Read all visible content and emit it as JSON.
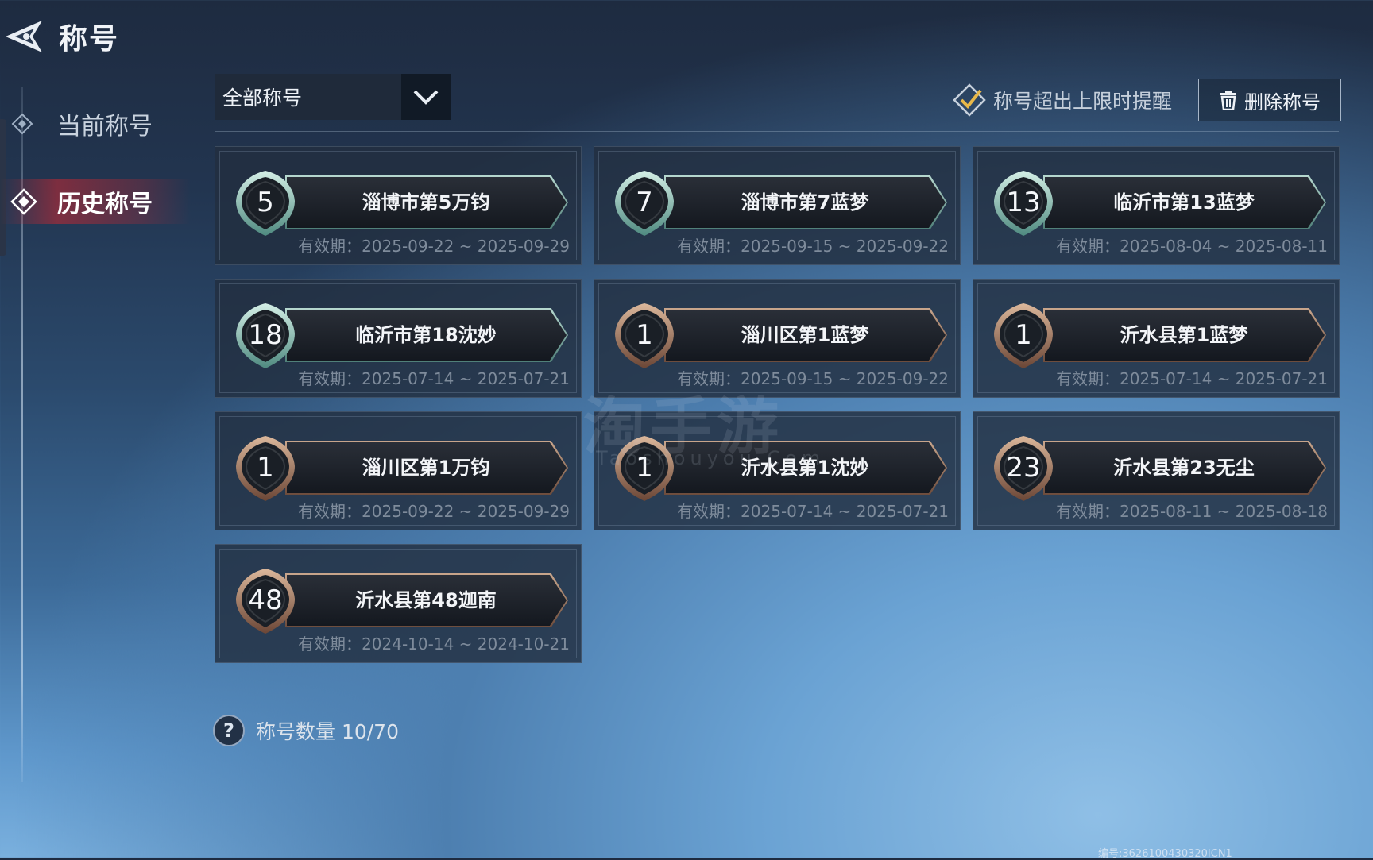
{
  "header": {
    "title": "称号"
  },
  "nav": {
    "current_label": "当前称号",
    "history_label": "历史称号"
  },
  "filter": {
    "selected": "全部称号"
  },
  "toolbar": {
    "reminder_label": "称号超出上限时提醒",
    "delete_label": "删除称号"
  },
  "validity_prefix": "有效期：",
  "cards": [
    {
      "rank": "5",
      "title": "淄博市第5万钧",
      "validity": "2025-09-22 ~ 2025-09-29",
      "style": "teal"
    },
    {
      "rank": "7",
      "title": "淄博市第7蓝梦",
      "validity": "2025-09-15 ~ 2025-09-22",
      "style": "teal"
    },
    {
      "rank": "13",
      "title": "临沂市第13蓝梦",
      "validity": "2025-08-04 ~ 2025-08-11",
      "style": "teal"
    },
    {
      "rank": "18",
      "title": "临沂市第18沈妙",
      "validity": "2025-07-14 ~ 2025-07-21",
      "style": "teal"
    },
    {
      "rank": "1",
      "title": "淄川区第1蓝梦",
      "validity": "2025-09-15 ~ 2025-09-22",
      "style": "bronze"
    },
    {
      "rank": "1",
      "title": "沂水县第1蓝梦",
      "validity": "2025-07-14 ~ 2025-07-21",
      "style": "bronze"
    },
    {
      "rank": "1",
      "title": "淄川区第1万钧",
      "validity": "2025-09-22 ~ 2025-09-29",
      "style": "bronze"
    },
    {
      "rank": "1",
      "title": "沂水县第1沈妙",
      "validity": "2025-07-14 ~ 2025-07-21",
      "style": "bronze"
    },
    {
      "rank": "23",
      "title": "沂水县第23无尘",
      "validity": "2025-08-11 ~ 2025-08-18",
      "style": "bronze"
    },
    {
      "rank": "48",
      "title": "沂水县第48迦南",
      "validity": "2024-10-14 ~ 2024-10-21",
      "style": "bronze"
    }
  ],
  "footer": {
    "count_label": "称号数量 10/70"
  },
  "watermark": {
    "main": "淘手游",
    "sub": "Taoshouyou.Com"
  },
  "serial": "编号:3626100430320ICN1",
  "colors": {
    "teal_accent": "#b6d8cf",
    "bronze_accent": "#c9a68c",
    "selected_nav": "#c8283a"
  }
}
